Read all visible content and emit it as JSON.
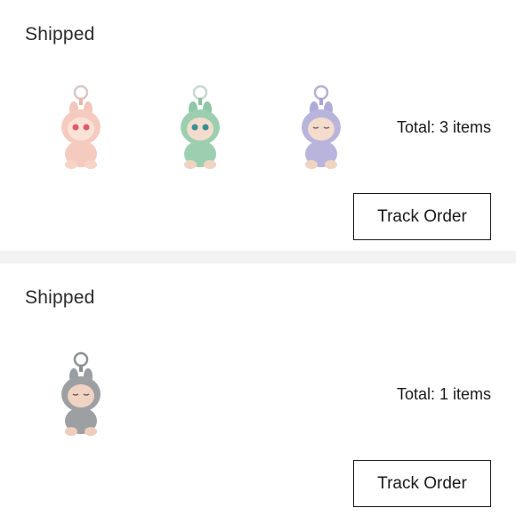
{
  "orders": [
    {
      "status": "Shipped",
      "total_label": "Total: 3 items",
      "track_label": "Track Order",
      "items": [
        {
          "icon": "plush-keychain-pink-icon",
          "color": "#f5cbbf"
        },
        {
          "icon": "plush-keychain-green-icon",
          "color": "#9ccfb0"
        },
        {
          "icon": "plush-keychain-lavender-icon",
          "color": "#b8b4dc"
        }
      ]
    },
    {
      "status": "Shipped",
      "total_label": "Total: 1 items",
      "track_label": "Track Order",
      "items": [
        {
          "icon": "plush-keychain-gray-icon",
          "color": "#9da0a3"
        }
      ]
    }
  ]
}
